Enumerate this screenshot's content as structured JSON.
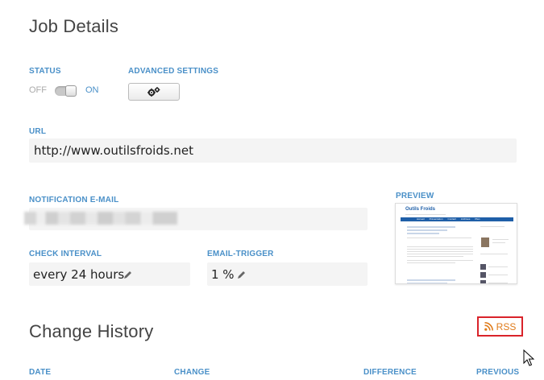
{
  "job_details": {
    "title": "Job Details",
    "status": {
      "label": "STATUS",
      "off": "OFF",
      "on": "ON"
    },
    "advanced": {
      "label": "ADVANCED SETTINGS",
      "icon": "gears-icon"
    },
    "url": {
      "label": "URL",
      "value": "http://www.outilsfroids.net"
    },
    "email": {
      "label": "NOTIFICATION E-MAIL"
    },
    "preview": {
      "label": "PREVIEW",
      "site_title": "Outils Froids",
      "nav": [
        "Accueil",
        "Présentation",
        "Contact",
        "Archives",
        "Plan"
      ]
    },
    "interval": {
      "label": "CHECK INTERVAL",
      "value": "every 24 hours"
    },
    "trigger": {
      "label": "EMAIL-TRIGGER",
      "value": "1 %"
    }
  },
  "history": {
    "title": "Change History",
    "rss_label": "RSS",
    "columns": [
      "DATE",
      "CHANGE",
      "DIFFERENCE",
      "PREVIOUS"
    ]
  },
  "colors": {
    "label_blue": "#4a90c8",
    "rss_orange": "#e07b1a",
    "rss_border": "#d9232a"
  }
}
